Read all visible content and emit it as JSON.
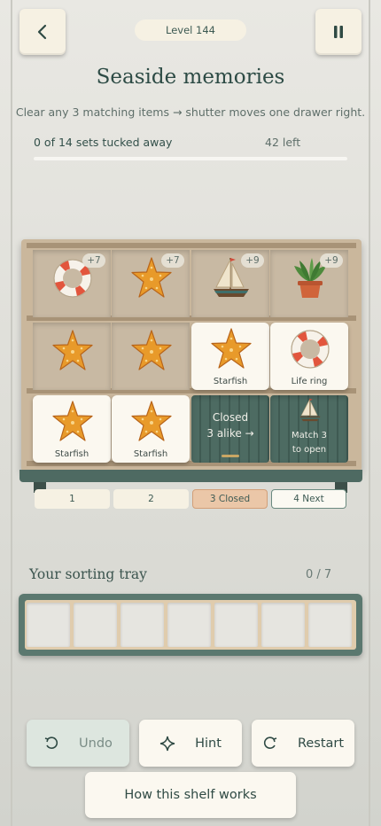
{
  "header": {
    "level_label": "Level 144",
    "title": "Seaside memories",
    "subtitle": "Clear any 3 matching items → shutter moves one drawer right."
  },
  "progress": {
    "text": "0 of 14 sets tucked away",
    "remaining": "42 left",
    "fraction": 0
  },
  "shelf": {
    "rows": [
      [
        {
          "item": "life-ring",
          "badge": "+7",
          "state": "back"
        },
        {
          "item": "starfish",
          "badge": "+7",
          "state": "back"
        },
        {
          "item": "sailboat",
          "badge": "+9",
          "state": "back"
        },
        {
          "item": "potted-plant",
          "badge": "+9",
          "state": "back"
        }
      ],
      [
        {
          "item": "starfish",
          "state": "back"
        },
        {
          "item": "starfish",
          "state": "back"
        },
        {
          "item": "starfish",
          "label": "Starfish",
          "state": "front"
        },
        {
          "item": "life-ring",
          "label": "Life ring",
          "state": "front"
        }
      ],
      [
        {
          "item": "starfish",
          "label": "Starfish",
          "state": "front"
        },
        {
          "item": "starfish",
          "label": "Starfish",
          "state": "front"
        },
        {
          "state": "closed",
          "line1": "Closed",
          "line2": "3 alike →"
        },
        {
          "item": "sailboat",
          "state": "locked",
          "line1": "Match 3",
          "line2": "to open"
        }
      ]
    ],
    "column_tabs": [
      {
        "label": "1",
        "state": "normal"
      },
      {
        "label": "2",
        "state": "normal"
      },
      {
        "label": "3  Closed",
        "state": "closed"
      },
      {
        "label": "4  Next",
        "state": "next"
      }
    ]
  },
  "tray": {
    "title": "Your sorting tray",
    "count": "0 / 7",
    "slots": 7
  },
  "actions": {
    "undo": "Undo",
    "hint": "Hint",
    "restart": "Restart",
    "how": "How this shelf works"
  },
  "colors": {
    "shelf_wood": "#cab79c",
    "shutter_green": "#4d6b62",
    "tray_green": "#5b786f",
    "accent_orange": "#e89a2a"
  }
}
